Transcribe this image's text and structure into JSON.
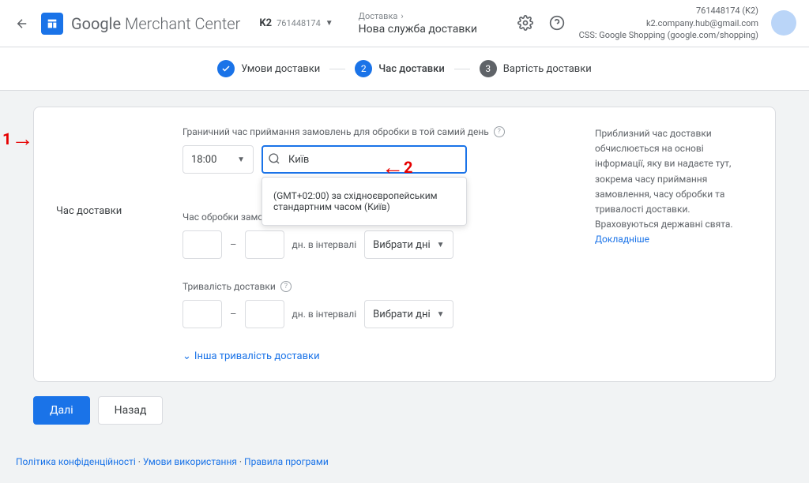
{
  "header": {
    "logo_text_strong": "Google",
    "logo_text_rest": " Merchant Center",
    "account_selector_label": "K2",
    "account_selector_id": "761448174",
    "breadcrumb_parent": "Доставка",
    "breadcrumb_title": "Нова служба доставки",
    "account_line1": "761448174 (K2)",
    "account_line2": "k2.company.hub@gmail.com",
    "account_line3": "CSS: Google Shopping (google.com/shopping)"
  },
  "stepper": {
    "step1": "Умови доставки",
    "step2": "Час доставки",
    "step3": "Вартість доставки"
  },
  "form": {
    "section_title": "Час доставки",
    "cutoff_label": "Граничний час приймання замовлень для обробки в той самий день",
    "cutoff_time": "18:00",
    "search_value": "Київ",
    "tz_option": "(GMT+02:00) за східноєвропейським стандартним часом (Київ)",
    "handling_label": "Час обробки замовлення",
    "transit_label": "Тривалість доставки",
    "range_unit": "дн. в інтервалі",
    "select_days": "Вибрати дні",
    "more_link": "Інша тривалість доставки"
  },
  "side_info": {
    "text": "Приблизний час доставки обчислюється на основі інформації, яку ви надаєте тут, зокрема часу приймання замовлення, часу обробки та тривалості доставки. Враховуються державні свята.",
    "link": "Докладніше"
  },
  "buttons": {
    "next": "Далі",
    "back": "Назад"
  },
  "footer": {
    "privacy": "Політика конфіденційності",
    "terms": "Умови використання",
    "rules": "Правила програми"
  },
  "markers": {
    "m1": "1",
    "m2": "2"
  }
}
